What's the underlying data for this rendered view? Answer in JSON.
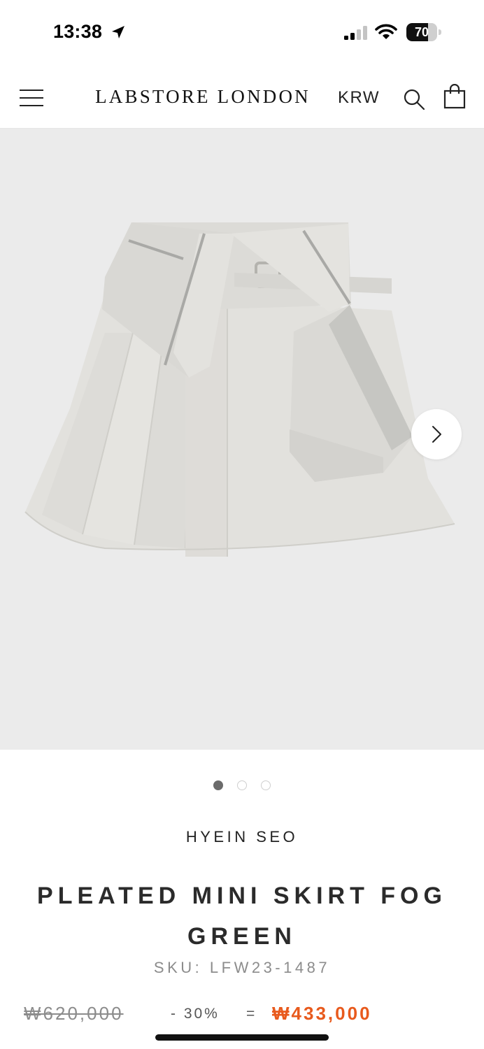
{
  "status_bar": {
    "time": "13:38",
    "battery_level": "70",
    "icons": [
      "location-arrow-icon",
      "signal-icon",
      "wifi-icon",
      "battery-icon"
    ]
  },
  "header": {
    "logo": "LABSTORE LONDON",
    "currency": "KRW",
    "icons": [
      "menu-icon",
      "search-icon",
      "shopping-bag-icon"
    ]
  },
  "gallery": {
    "image_count": 3,
    "active_index": 0,
    "next_icon": "chevron-right-icon"
  },
  "product": {
    "brand": "HYEIN SEO",
    "title": "PLEATED MINI SKIRT FOG GREEN",
    "sku_label": "SKU:",
    "sku_value": "LFW23-1487",
    "price_original": "₩620,000",
    "discount": "- 30%",
    "equals": "=",
    "price_sale": "₩433,000"
  },
  "colors": {
    "accent_sale": "#e85a1d",
    "gallery_bg": "#ebebeb",
    "text": "#222222"
  }
}
